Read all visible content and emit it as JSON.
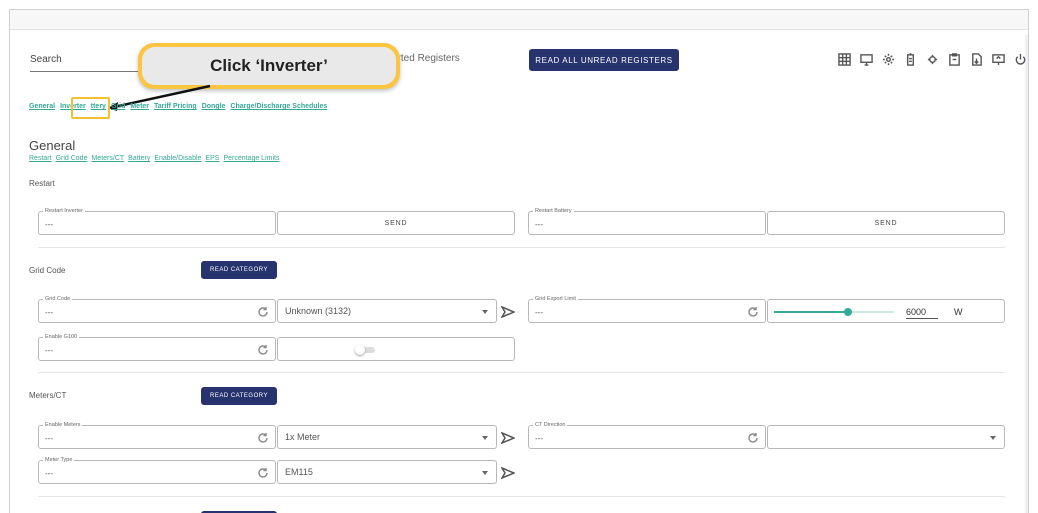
{
  "toolbar": {
    "search_label": "Search",
    "reported_registers": "orted Registers",
    "read_all_label": "READ ALL UNREAD REGISTERS",
    "icons": [
      "grid-icon",
      "monitor-icon",
      "settings-icon",
      "battery-icon",
      "gear-icon",
      "clipboard-icon",
      "download-file-icon",
      "screen-arrow-icon",
      "power-icon"
    ]
  },
  "callout": {
    "text": "Click ‘Inverter’"
  },
  "nav": [
    "General",
    "Inverter",
    "ttery",
    "Grid",
    "Meter",
    "Tariff Pricing",
    "Dongle",
    "Charge/Discharge Schedules"
  ],
  "general": {
    "title": "General",
    "subnav": [
      "Restart",
      "Grid Code",
      "Meters/CT",
      "Battery",
      "Enable/Disable",
      "EPS",
      "Percentage Limits"
    ],
    "restart_label": "Restart"
  },
  "restart": {
    "inverter": {
      "label": "Restart Inverter",
      "value": "---",
      "send": "SEND"
    },
    "battery": {
      "label": "Restart Battery",
      "value": "---",
      "send": "SEND"
    }
  },
  "grid_code": {
    "section": "Grid Code",
    "read_category": "READ CATEGORY",
    "grid_code_field": {
      "label": "Grid Code",
      "value": "---",
      "selected": "Unknown (3132)"
    },
    "export_limit": {
      "label": "Grid Export Limit",
      "value": "---",
      "slider_value": "6000",
      "unit": "W",
      "slider_fraction": 0.62
    },
    "enable_g100": {
      "label": "Enable G100",
      "value": "---",
      "toggle_on": false
    }
  },
  "meters": {
    "section": "Meters/CT",
    "read_category": "READ CATEGORY",
    "enable_meters": {
      "label": "Enable Meters",
      "value": "---",
      "selected": "1x Meter"
    },
    "ct_direction": {
      "label": "CT Direction",
      "value": "---",
      "selected": ""
    },
    "meter_type": {
      "label": "Meter Type",
      "value": "---",
      "selected": "EM115"
    }
  },
  "colors": {
    "accent": "#35a897",
    "button": "#26336f",
    "callout_border": "#fbc542"
  }
}
